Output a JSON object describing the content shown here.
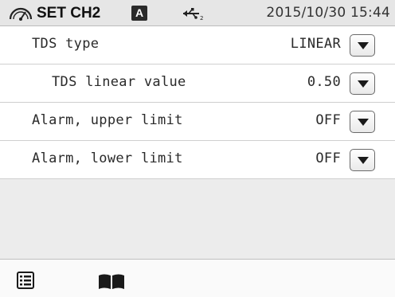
{
  "status_bar": {
    "title": "SET CH2",
    "mode_badge": "A",
    "datetime": "2015/10/30 15:44",
    "gauge_icon": "gauge-icon",
    "usb_icon": "usb-icon"
  },
  "settings": [
    {
      "label": "TDS type",
      "value": "LINEAR"
    },
    {
      "label": "TDS linear value",
      "value": "0.50"
    },
    {
      "label": "Alarm, upper limit",
      "value": "OFF"
    },
    {
      "label": "Alarm, lower limit",
      "value": "OFF"
    }
  ],
  "bottom_bar": {
    "icons": [
      "list-menu-icon",
      "manual-book-icon"
    ]
  },
  "colors": {
    "background": "#ececec",
    "list_background": "#ffffff",
    "badge": "#2a2a2a",
    "text": "#2a2a2a"
  }
}
